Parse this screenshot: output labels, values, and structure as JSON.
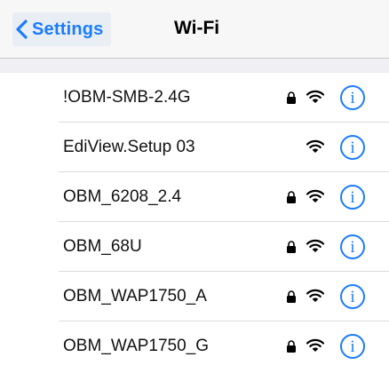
{
  "navbar": {
    "back_label": "Settings",
    "back_icon": "chevron-left-icon",
    "title": "Wi-Fi"
  },
  "networks": [
    {
      "name": "!OBM-SMB-2.4G",
      "secured": true,
      "info": "i"
    },
    {
      "name": "EdiView.Setup 03",
      "secured": false,
      "info": "i"
    },
    {
      "name": "OBM_6208_2.4",
      "secured": true,
      "info": "i"
    },
    {
      "name": "OBM_68U",
      "secured": true,
      "info": "i"
    },
    {
      "name": "OBM_WAP1750_A",
      "secured": true,
      "info": "i"
    },
    {
      "name": "OBM_WAP1750_G",
      "secured": true,
      "info": "i"
    }
  ],
  "colors": {
    "accent": "#1a7cff",
    "navbar_bg": "#f7f7f7",
    "section_bg": "#efeff4"
  }
}
